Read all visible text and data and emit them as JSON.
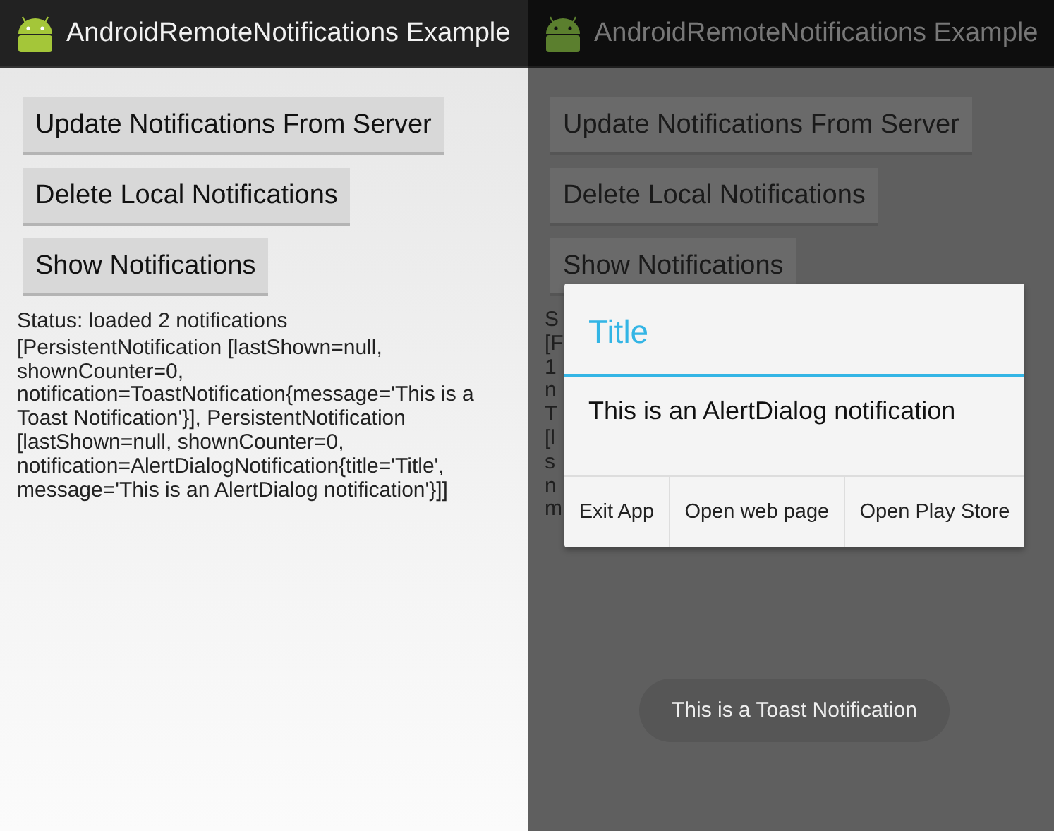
{
  "screens": [
    {
      "dimmed": false,
      "action_bar": {
        "title": "AndroidRemoteNotifications Example"
      },
      "buttons": [
        "Update Notifications From Server",
        "Delete Local Notifications",
        "Show Notifications"
      ],
      "status": "Status: loaded 2 notifications",
      "details": "[PersistentNotification [lastShown=null, shownCounter=0, notification=ToastNotification{message='This is a Toast Notification'}], PersistentNotification [lastShown=null, shownCounter=0, notification=AlertDialogNotification{title='Title', message='This is an AlertDialog notification'}]]"
    },
    {
      "dimmed": true,
      "action_bar": {
        "title": "AndroidRemoteNotifications Example"
      },
      "buttons": [
        "Update Notifications From Server",
        "Delete Local Notifications",
        "Show Notifications"
      ],
      "text_fragments": [
        "S",
        "[F",
        "1",
        "n",
        "T",
        "[l",
        "s",
        "n",
        "m"
      ],
      "dialog": {
        "title": "Title",
        "message": "This is an AlertDialog notification",
        "buttons": [
          "Exit App",
          "Open web page",
          "Open Play Store"
        ]
      },
      "toast": "This is a Toast Notification"
    }
  ]
}
